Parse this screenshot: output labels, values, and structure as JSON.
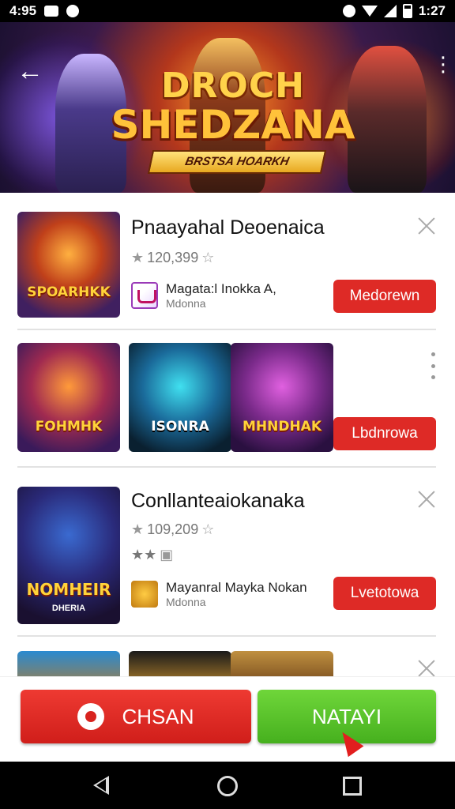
{
  "status_bar": {
    "time": "4:95",
    "clock": "1:27"
  },
  "banner": {
    "title_line1": "DROCH",
    "title_line2": "SHEDZANA",
    "ribbon": "BRSTSA HOARKH",
    "back_glyph": "←",
    "more_glyph": "⋮"
  },
  "items": [
    {
      "title": "Pnaayahal Deoenaica",
      "rating": "120,399",
      "developer": "Magata:l Inokka A,",
      "developer_sub": "Mdonna",
      "button": "Medorewn",
      "thumb_label": "SPOARHKK",
      "thumb_sub": ""
    },
    {
      "thumb_labels": [
        "FOHMHK",
        "ISONRA",
        "MHNDHAK"
      ],
      "button": "Lbdnrowa"
    },
    {
      "title": "Conllanteaiokanaka",
      "rating": "109,209",
      "secondary_rating": "★★",
      "developer": "Mayanral Mayka Nokan",
      "developer_sub": "Mdonna",
      "button": "Lvetotowa",
      "thumb_label": "NOMHEIR",
      "thumb_sub": "DHERIA"
    }
  ],
  "actions": {
    "primary_label": "CHSAN",
    "secondary_label": "NATAYI"
  },
  "colors": {
    "red": "#de2a26",
    "green": "#56c02a",
    "banner_gold": "#ffd24a"
  },
  "icons": [
    "back-arrow-icon",
    "more-vert-icon",
    "close-icon",
    "star-icon",
    "gear-icon",
    "nav-back-icon",
    "nav-home-icon",
    "nav-recents-icon"
  ]
}
